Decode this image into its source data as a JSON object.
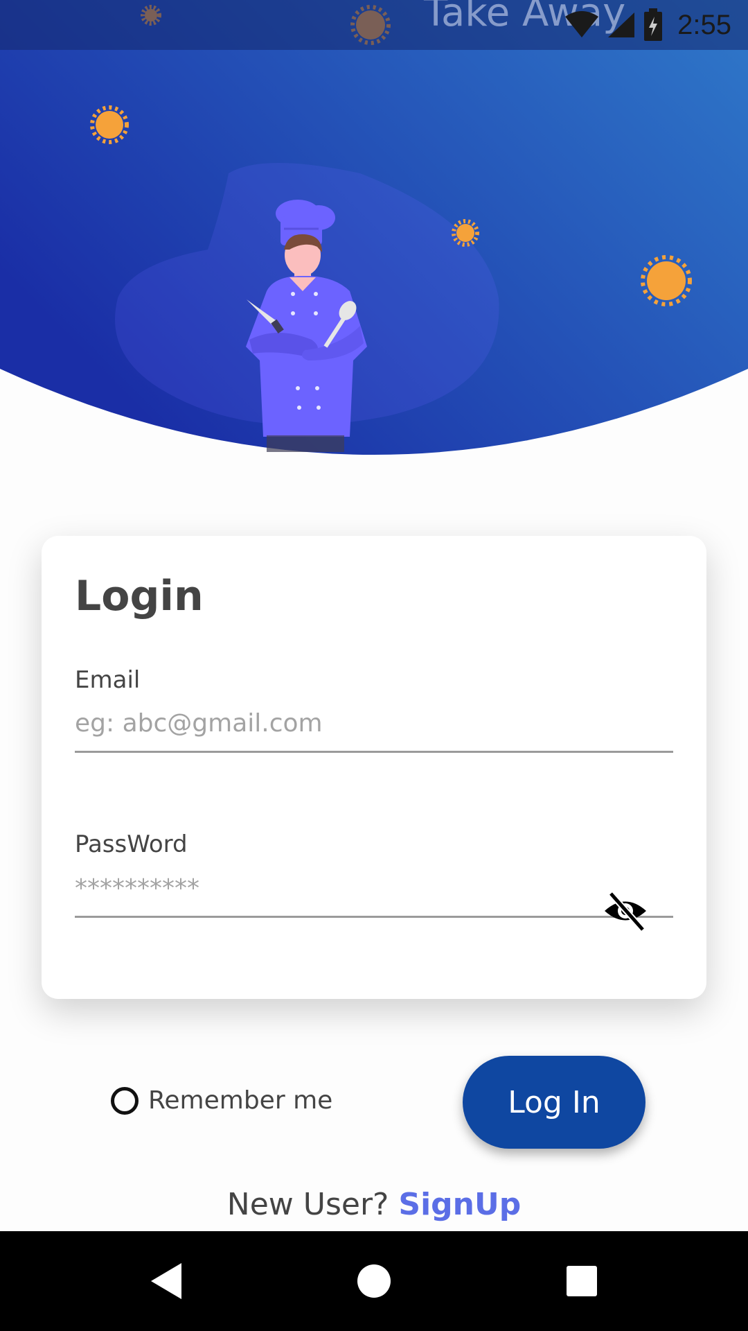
{
  "status_bar": {
    "app_title": "Take Away",
    "time": "2:55",
    "icons": [
      "wifi-icon",
      "cell-signal-icon",
      "battery-charging-icon"
    ]
  },
  "header": {
    "illustration": "chef-illustration",
    "colors": {
      "gradient_start": "#1a2fa8",
      "gradient_end": "#2f78c9",
      "chef": "#6c63ff"
    }
  },
  "login_card": {
    "title": "Login",
    "email": {
      "label": "Email",
      "placeholder": "eg: abc@gmail.com",
      "value": ""
    },
    "password": {
      "label": "PassWord",
      "placeholder": "**********",
      "value": "",
      "toggle_icon": "eye-off-icon"
    }
  },
  "remember_me": {
    "label": "Remember me",
    "checked": false
  },
  "login_button": {
    "label": "Log In",
    "color": "#0f47a1"
  },
  "signup": {
    "prompt": "New User?",
    "link": "SignUp",
    "link_color": "#5b6ee6"
  },
  "nav_bar": {
    "buttons": [
      "back-icon",
      "home-icon",
      "recents-icon"
    ]
  }
}
